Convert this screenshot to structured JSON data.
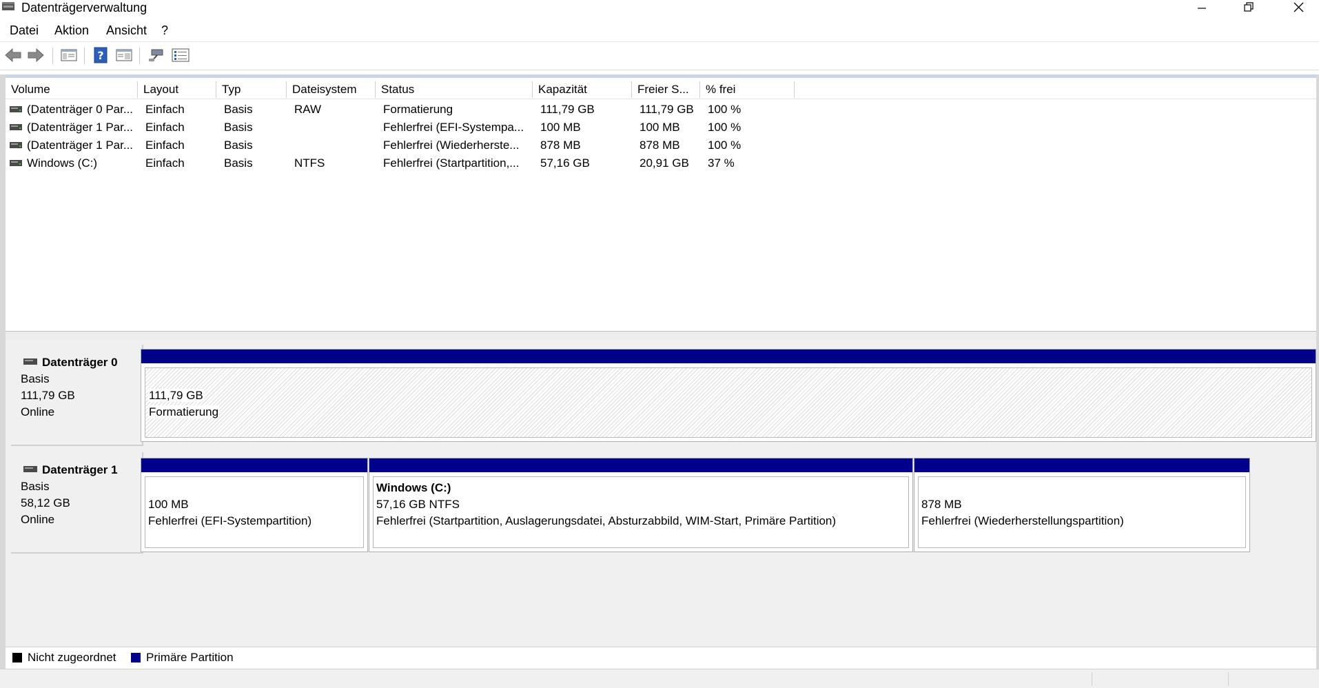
{
  "window": {
    "title": "Datenträgerverwaltung",
    "controls": [
      "minimize",
      "restore",
      "close"
    ]
  },
  "menu": [
    "Datei",
    "Aktion",
    "Ansicht",
    "?"
  ],
  "toolbar": {
    "icons": [
      "back-arrow-icon",
      "forward-arrow-icon",
      "console-tree-icon",
      "help-icon",
      "properties-view-icon",
      "connect-icon",
      "list-view-icon"
    ]
  },
  "volume_table": {
    "columns": [
      "Volume",
      "Layout",
      "Typ",
      "Dateisystem",
      "Status",
      "Kapazität",
      "Freier S...",
      "% frei"
    ],
    "rows": [
      {
        "volume": "(Datenträger 0 Par...",
        "layout": "Einfach",
        "typ": "Basis",
        "fs": "RAW",
        "status": "Formatierung",
        "capacity": "111,79 GB",
        "free": "111,79 GB",
        "pct": "100 %"
      },
      {
        "volume": "(Datenträger 1 Par...",
        "layout": "Einfach",
        "typ": "Basis",
        "fs": "",
        "status": "Fehlerfrei (EFI-Systempa...",
        "capacity": "100 MB",
        "free": "100 MB",
        "pct": "100 %"
      },
      {
        "volume": "(Datenträger 1 Par...",
        "layout": "Einfach",
        "typ": "Basis",
        "fs": "",
        "status": "Fehlerfrei (Wiederherste...",
        "capacity": "878 MB",
        "free": "878 MB",
        "pct": "100 %"
      },
      {
        "volume": "Windows (C:)",
        "layout": "Einfach",
        "typ": "Basis",
        "fs": "NTFS",
        "status": "Fehlerfrei (Startpartition,...",
        "capacity": "57,16 GB",
        "free": "20,91 GB",
        "pct": "37 %"
      }
    ]
  },
  "disks": [
    {
      "name": "Datenträger 0",
      "type": "Basis",
      "size": "111,79 GB",
      "state": "Online",
      "partitions": [
        {
          "title": "",
          "size": "111,79 GB",
          "status": "Formatierung"
        }
      ]
    },
    {
      "name": "Datenträger 1",
      "type": "Basis",
      "size": "58,12 GB",
      "state": "Online",
      "partitions": [
        {
          "title": "",
          "size": "100 MB",
          "status": "Fehlerfrei (EFI-Systempartition)"
        },
        {
          "title": "Windows  (C:)",
          "size": "57,16 GB NTFS",
          "status": "Fehlerfrei (Startpartition, Auslagerungsdatei, Absturzabbild, WIM-Start, Primäre Partition)"
        },
        {
          "title": "",
          "size": "878 MB",
          "status": "Fehlerfrei (Wiederherstellungspartition)"
        }
      ]
    }
  ],
  "legend": [
    {
      "label": "Nicht zugeordnet",
      "color": "#000000"
    },
    {
      "label": "Primäre Partition",
      "color": "#00008b"
    }
  ],
  "colors": {
    "primary_partition": "#00008b",
    "unallocated": "#000000"
  }
}
